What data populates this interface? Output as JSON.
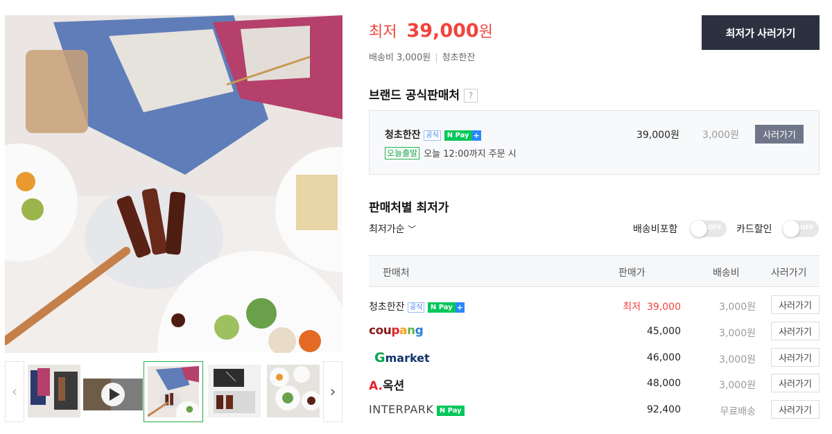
{
  "price": {
    "label": "최저",
    "amount": "39,000",
    "unit": "원"
  },
  "shipping_info": {
    "fee": "배송비 3,000원",
    "seller": "청초한잔"
  },
  "buy_main_label": "최저가 사러가기",
  "official": {
    "title": "브랜드 공식판매처",
    "help": "?",
    "seller": "청초한잔",
    "badge": "공식",
    "npay": "N Pay",
    "npay_plus": "+",
    "price": "39,000원",
    "shipping": "3,000원",
    "buy_label": "사러가기",
    "today_badge": "오늘출발",
    "today_text": "오늘 12:00까지 주문 시"
  },
  "sellers_section": {
    "title": "판매처별 최저가",
    "sort": "최저가순",
    "toggles": [
      {
        "label": "배송비포함",
        "state": "OFF"
      },
      {
        "label": "카드할인",
        "state": "OFF"
      }
    ]
  },
  "table": {
    "headers": [
      "판매처",
      "판매가",
      "배송비",
      "사러가기"
    ],
    "rows": [
      {
        "seller": "청초한잔",
        "official_badge": "공식",
        "npay": "N Pay",
        "npay_plus": "+",
        "price_prefix": "최저",
        "price": "39,000",
        "shipping": "3,000원",
        "buy": "사러가기"
      },
      {
        "seller_logo": "coupang",
        "price": "45,000",
        "shipping": "3,000원",
        "buy": "사러가기"
      },
      {
        "seller_logo": "Gmarket",
        "price": "46,000",
        "shipping": "3,000원",
        "buy": "사러가기"
      },
      {
        "seller_logo": "A.옥션",
        "price": "48,000",
        "shipping": "3,000원",
        "buy": "사러가기"
      },
      {
        "seller_logo": "INTERPARK",
        "npay": "N Pay",
        "price": "92,400",
        "shipping": "무료배송",
        "buy": "사러가기"
      }
    ]
  },
  "gallery": {
    "thumbnails": [
      "product-set",
      "video",
      "main-dish",
      "gift-box",
      "table-spread"
    ],
    "active": 2,
    "video_icon": "play-icon"
  },
  "colors": {
    "accent_red": "#f0443c",
    "dark_button": "#2c3140",
    "npay_green": "#03c75a",
    "thumb_active": "#22aa44"
  }
}
